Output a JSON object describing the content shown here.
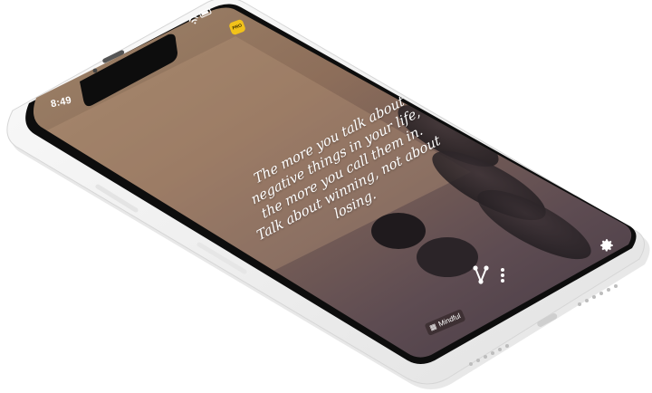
{
  "status_bar": {
    "time": "8:49"
  },
  "app": {
    "badge_label": "PRO",
    "quote_lines": [
      "The more you talk about",
      "negative things in your life,",
      "the more you call them in.",
      "Talk about winning, not about",
      "losing."
    ],
    "category_label": "Mindful",
    "icons": {
      "settings": "gear-icon",
      "share": "share-icon",
      "more": "more-vertical-icon",
      "category": "book-icon",
      "wifi": "wifi-icon",
      "battery": "battery-icon"
    }
  },
  "colors": {
    "badge": "#f2c21a",
    "frame": "#f1f1f1",
    "screen_top": "#9a7a5c",
    "screen_bottom": "#4a3c44"
  }
}
